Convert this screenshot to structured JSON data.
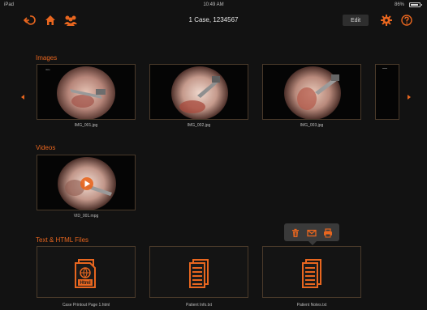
{
  "status_bar": {
    "carrier": "iPad",
    "time": "10:49 AM",
    "battery": "86%",
    "battery_level": 0.86
  },
  "nav": {
    "title": "1 Case, 1234567",
    "edit_label": "Edit",
    "icons": [
      "back-icon",
      "home-icon",
      "patients-icon",
      "gear-icon",
      "help-icon"
    ]
  },
  "images": {
    "label": "Images",
    "items": [
      {
        "caption": "IMG_001.jpg",
        "overlay_text": "IMG"
      },
      {
        "caption": "IMG_002.jpg"
      },
      {
        "caption": "IMG_003.jpg"
      }
    ]
  },
  "videos": {
    "label": "Videos",
    "items": [
      {
        "caption": "VID_001.mpg"
      }
    ]
  },
  "files": {
    "label": "Text & HTML Files",
    "items": [
      {
        "caption": "Case Printout Page 1.html",
        "icon": "html-file-icon",
        "icon_text": "Html"
      },
      {
        "caption": "Patient Info.txt",
        "icon": "text-file-icon"
      },
      {
        "caption": "Patient Notes.txt",
        "icon": "text-file-icon"
      }
    ]
  },
  "popover": {
    "actions": [
      "trash-icon",
      "mail-icon",
      "print-icon"
    ]
  },
  "colors": {
    "accent": "#e8661f",
    "background": "#121212"
  }
}
